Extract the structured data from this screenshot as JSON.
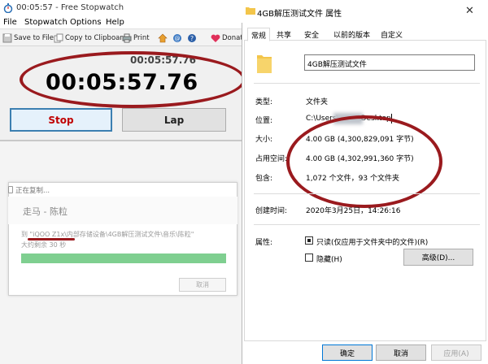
{
  "stopwatch": {
    "title": "00:05:57 - Free Stopwatch",
    "menu": [
      "File",
      "Stopwatch",
      "Options",
      "Help"
    ],
    "toolbar": {
      "save": "Save to File",
      "copy": "Copy to Clipboard",
      "print": "Print",
      "donate": "Donat"
    },
    "small_time": "00:05:57.76",
    "big_time": "00:05:57.76",
    "stop_label": "Stop",
    "lap_label": "Lap",
    "colors": {
      "stop_text": "#c00000",
      "annotation": "#9a1a1e"
    }
  },
  "copy_dialog": {
    "title": "正在复制...",
    "song": "走马 - 陈粒",
    "path": "到 \"iQOO Z1x\\内部存储设备\\4GB解压测试文件\\音乐\\陈粒\"",
    "remaining": "大约剩余 30 秒",
    "progress": 1.0,
    "cancel": "取消"
  },
  "properties": {
    "title": "4GB解压测试文件 属性",
    "close": "✕",
    "tabs": [
      "常规",
      "共享",
      "安全",
      "以前的版本",
      "自定义"
    ],
    "name": "4GB解压测试文件",
    "type_label": "类型:",
    "type_value": "文件夹",
    "location_label": "位置:",
    "location_value": "C:\\Users\\",
    "location_suffix": "\\Desktop",
    "size_label": "大小:",
    "size_value": "4.00 GB (4,300,829,091 字节)",
    "disk_label": "占用空间:",
    "disk_value": "4.00 GB (4,302,991,360 字节)",
    "contains_label": "包含:",
    "contains_value": "1,072 个文件，93 个文件夹",
    "created_label": "创建时间:",
    "created_value": "2020年3月25日，14:26:16",
    "attr_label": "属性:",
    "readonly_label": "只读(仅应用于文件夹中的文件)(R)",
    "hidden_label": "隐藏(H)",
    "advanced": "高级(D)...",
    "ok": "确定",
    "cancel": "取消",
    "apply": "应用(A)"
  }
}
